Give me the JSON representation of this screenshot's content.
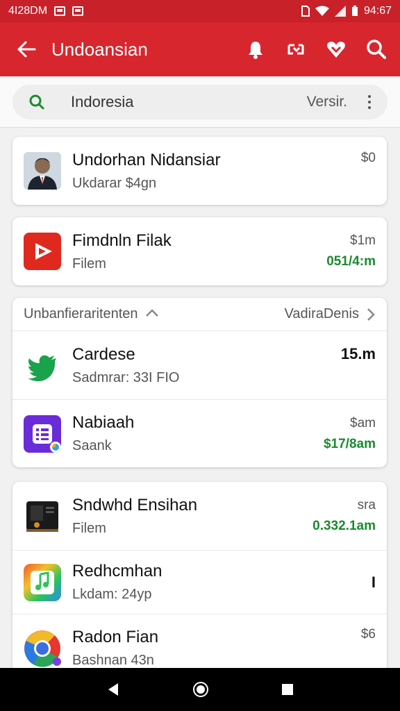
{
  "status_bar": {
    "left_text": "4I28DM",
    "time": "94:67",
    "icons": [
      "mail-icon",
      "mail-icon",
      "sim-icon",
      "wifi-icon",
      "signal-icon",
      "battery-icon"
    ]
  },
  "app_bar": {
    "title": "Undoansian",
    "icons": [
      "back-arrow-icon",
      "bell-icon",
      "refresh-icon",
      "heart-icon",
      "search-icon"
    ],
    "color": "#d8262e"
  },
  "search": {
    "value": "Indoresia",
    "right_label": "Versir."
  },
  "items_top": [
    {
      "name": "Undorhan Nidansiar",
      "sub": "Ukdarar $4gn",
      "value": "$0",
      "value2": "",
      "icon": "person-avatar-icon"
    },
    {
      "name": "Fimdnln Filak",
      "sub": "Filem",
      "value": "$1m",
      "value2": "051/4:m",
      "icon": "youtube-play-icon"
    }
  ],
  "group": {
    "header_left": "Unbanfieraritenten",
    "header_right": "VadiraDenis",
    "items": [
      {
        "name": "Cardese",
        "sub": "Sadmrar: 33I FIO",
        "value": "15.m",
        "value2": "",
        "icon": "twitter-bird-icon"
      },
      {
        "name": "Nabiaah",
        "sub": "Saank",
        "value": "$am",
        "value2": "$17/8am",
        "icon": "list-app-icon"
      }
    ]
  },
  "items_bottom": [
    {
      "name": "Sndwhd Ensihan",
      "sub": "Filem",
      "value": "sra",
      "value2": "0.332.1am",
      "icon": "device-icon"
    },
    {
      "name": "Redhcmhan",
      "sub": "Lkdam: 24yp",
      "value": "I",
      "value2": "",
      "icon": "music-note-icon"
    },
    {
      "name": "Radon Fian",
      "sub": "Bashnan 43n",
      "value": "$6",
      "value2": "",
      "icon": "chrome-icon"
    }
  ],
  "accent_green": "#1a8a2e"
}
